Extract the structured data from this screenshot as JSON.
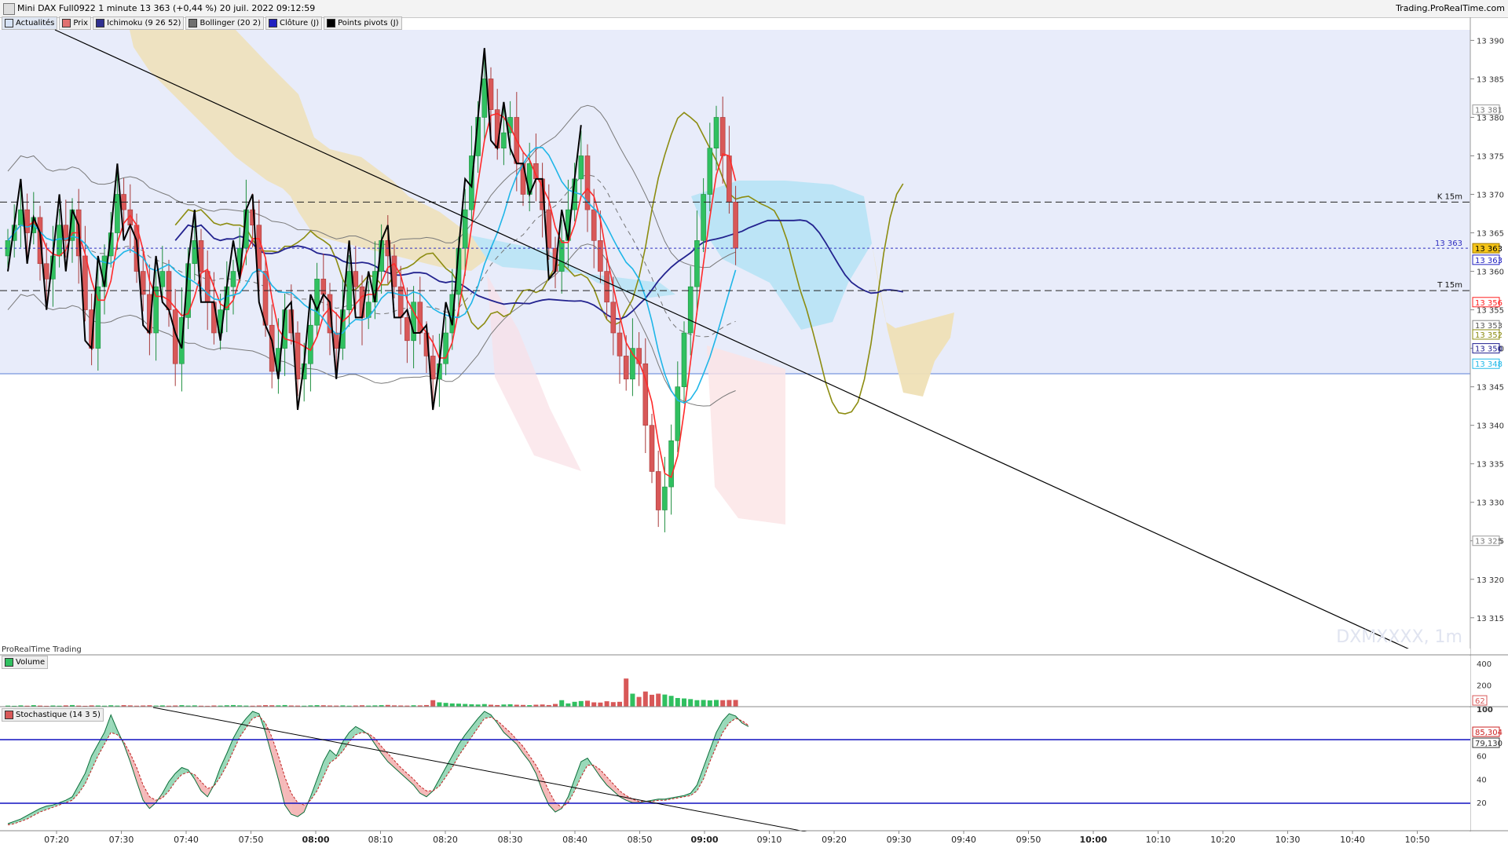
{
  "window": {
    "title": "Mini DAX Full0922 1 minute 13 363 (+0,44 %) 20 juil. 2022 09:12:59",
    "brand": "Trading.ProRealTime.com"
  },
  "legend": [
    {
      "label": "Actualités",
      "color": "#d6e2f5",
      "icon": "news-icon"
    },
    {
      "label": "Prix",
      "color": "#e07070",
      "icon": "price-icon"
    },
    {
      "label": "Ichimoku (9 26 52)",
      "color": "#303090",
      "icon": "ichimoku-icon"
    },
    {
      "label": "Bollinger (20 2)",
      "color": "#707070",
      "icon": "bollinger-icon"
    },
    {
      "label": "Clôture (J)",
      "color": "#2020c0",
      "icon": "close-daily-icon"
    },
    {
      "label": "Points pivots (J)",
      "color": "#000000",
      "icon": "pivot-icon"
    }
  ],
  "price_panel": {
    "axis_ticks": [
      "13 390",
      "13 385",
      "13 380",
      "13 375",
      "13 370",
      "13 365",
      "13 360",
      "13 355",
      "13 350",
      "13 345",
      "13 340",
      "13 335",
      "13 330",
      "13 325",
      "13 320",
      "13 315"
    ],
    "levels": [
      {
        "label": "K 15m",
        "value": 13369.0,
        "style": "dash-black"
      },
      {
        "label": "T 15m",
        "value": 13357.5,
        "style": "dash-black"
      },
      {
        "label": "13 363",
        "value": 13363.0,
        "style": "dot-blue"
      }
    ],
    "right_tags": [
      {
        "text": "13 381",
        "value": 13381,
        "fill": "#ffffff",
        "stroke": "#999999",
        "color": "#777777"
      },
      {
        "text": "13 363",
        "value": 13363,
        "fill": "#f5c518",
        "stroke": "#a07800",
        "color": "#000000"
      },
      {
        "text": "13 363",
        "value": 13361.5,
        "fill": "#ffffff",
        "stroke": "#2020c0",
        "color": "#2020c0"
      },
      {
        "text": "13 356",
        "value": 13356,
        "fill": "#ffffff",
        "stroke": "#ff2020",
        "color": "#ff2020"
      },
      {
        "text": "13 353",
        "value": 13353,
        "fill": "#ffffff",
        "stroke": "#888888",
        "color": "#555555"
      },
      {
        "text": "13 352",
        "value": 13351.8,
        "fill": "#ffffff",
        "stroke": "#8c8c10",
        "color": "#8c8c10"
      },
      {
        "text": "13 350",
        "value": 13350,
        "fill": "#ffffff",
        "stroke": "#202090",
        "color": "#202090"
      },
      {
        "text": "13 348",
        "value": 13348,
        "fill": "#ffffff",
        "stroke": "#20b8e8",
        "color": "#20b8e8"
      },
      {
        "text": "13 325",
        "value": 13325,
        "fill": "#ffffff",
        "stroke": "#999999",
        "color": "#777777"
      }
    ],
    "watermark": "DXMXXXX, 1m",
    "footer_label": "ProRealTime Trading"
  },
  "volume_panel": {
    "label": "Volume",
    "axis_ticks": [
      "400",
      "200"
    ],
    "tag": "62"
  },
  "stoch_panel": {
    "label": "Stochastique (14 3 5)",
    "axis_ticks": [
      "100",
      "80",
      "60",
      "40",
      "20"
    ],
    "tags": [
      {
        "text": "85,304",
        "color": "#cc2020"
      },
      {
        "text": "79,130",
        "color": "#333333"
      }
    ]
  },
  "time_axis": [
    {
      "label": "07:20",
      "bold": false
    },
    {
      "label": "07:30",
      "bold": false
    },
    {
      "label": "07:40",
      "bold": false
    },
    {
      "label": "07:50",
      "bold": false
    },
    {
      "label": "08:00",
      "bold": true
    },
    {
      "label": "08:10",
      "bold": false
    },
    {
      "label": "08:20",
      "bold": false
    },
    {
      "label": "08:30",
      "bold": false
    },
    {
      "label": "08:40",
      "bold": false
    },
    {
      "label": "08:50",
      "bold": false
    },
    {
      "label": "09:00",
      "bold": true
    },
    {
      "label": "09:10",
      "bold": false
    },
    {
      "label": "09:20",
      "bold": false
    },
    {
      "label": "09:30",
      "bold": false
    },
    {
      "label": "09:40",
      "bold": false
    },
    {
      "label": "09:50",
      "bold": false
    },
    {
      "label": "10:00",
      "bold": true
    },
    {
      "label": "10:10",
      "bold": false
    },
    {
      "label": "10:20",
      "bold": false
    },
    {
      "label": "10:30",
      "bold": false
    },
    {
      "label": "10:40",
      "bold": false
    },
    {
      "label": "10:50",
      "bold": false
    }
  ],
  "colors": {
    "up": "#30c060",
    "down": "#d85858",
    "panel_bg": "#e8ecfa"
  },
  "chart_data": {
    "type": "candlestick",
    "title": "Mini DAX Full0922 1 minute",
    "ylim": [
      13311,
      13393
    ],
    "close_series_note": "",
    "closes": [
      13364,
      13366,
      13368,
      13365,
      13367,
      13361,
      13359,
      13362,
      13366,
      13364,
      13368,
      13362,
      13355,
      13350,
      13358,
      13362,
      13365,
      13370,
      13368,
      13366,
      13360,
      13357,
      13352,
      13358,
      13360,
      13355,
      13348,
      13354,
      13361,
      13364,
      13360,
      13356,
      13352,
      13355,
      13358,
      13360,
      13363,
      13368,
      13366,
      13360,
      13353,
      13347,
      13350,
      13355,
      13352,
      13346,
      13348,
      13353,
      13359,
      13357,
      13352,
      13350,
      13355,
      13360,
      13358,
      13354,
      13356,
      13360,
      13364,
      13362,
      13358,
      13354,
      13351,
      13356,
      13352,
      13349,
      13346,
      13348,
      13352,
      13357,
      13363,
      13368,
      13375,
      13380,
      13385,
      13381,
      13376,
      13378,
      13380,
      13374,
      13370,
      13374,
      13372,
      13368,
      13363,
      13360,
      13364,
      13368,
      13372,
      13375,
      13368,
      13364,
      13360,
      13356,
      13352,
      13349,
      13346,
      13350,
      13348,
      13340,
      13334,
      13329,
      13332,
      13338,
      13345,
      13352,
      13358,
      13364,
      13370,
      13376,
      13380,
      13375,
      13369,
      13363
    ],
    "volumes": [
      10,
      8,
      12,
      9,
      14,
      10,
      8,
      11,
      9,
      12,
      15,
      10,
      8,
      12,
      11,
      9,
      13,
      10,
      14,
      12,
      9,
      11,
      13,
      10,
      12,
      9,
      11,
      14,
      10,
      12,
      9,
      8,
      11,
      10,
      13,
      15,
      12,
      10,
      9,
      11,
      14,
      13,
      12,
      15,
      11,
      10,
      9,
      12,
      14,
      13,
      11,
      10,
      12,
      9,
      11,
      13,
      10,
      12,
      14,
      16,
      12,
      11,
      10,
      13,
      12,
      15,
      60,
      40,
      35,
      30,
      28,
      25,
      22,
      20,
      24,
      18,
      15,
      20,
      22,
      18,
      16,
      14,
      18,
      20,
      15,
      25,
      60,
      30,
      45,
      52,
      55,
      40,
      38,
      50,
      42,
      45,
      260,
      120,
      90,
      140,
      110,
      120,
      112,
      100,
      80,
      76,
      70,
      60,
      62,
      58,
      62,
      60,
      62,
      62
    ],
    "stochastic_k": [
      2,
      4,
      6,
      9,
      12,
      15,
      17,
      18,
      20,
      22,
      25,
      35,
      45,
      60,
      70,
      80,
      95,
      82,
      70,
      55,
      38,
      22,
      15,
      20,
      28,
      38,
      45,
      50,
      48,
      40,
      30,
      25,
      35,
      50,
      62,
      75,
      85,
      92,
      98,
      96,
      80,
      60,
      40,
      18,
      10,
      8,
      12,
      25,
      40,
      55,
      65,
      60,
      72,
      80,
      85,
      82,
      78,
      70,
      62,
      55,
      50,
      45,
      40,
      35,
      28,
      25,
      30,
      40,
      50,
      60,
      70,
      78,
      85,
      92,
      98,
      95,
      88,
      80,
      75,
      70,
      62,
      55,
      45,
      30,
      18,
      12,
      15,
      25,
      40,
      55,
      58,
      50,
      42,
      35,
      30,
      25,
      22,
      20,
      20,
      21,
      22,
      23,
      23,
      24,
      25,
      26,
      28,
      35,
      50,
      65,
      80,
      90,
      96,
      94,
      88,
      85
    ],
    "stochastic_d": [
      1,
      2,
      4,
      6,
      9,
      12,
      14,
      16,
      18,
      20,
      22,
      28,
      36,
      48,
      60,
      70,
      80,
      78,
      72,
      62,
      50,
      35,
      25,
      22,
      24,
      30,
      38,
      44,
      46,
      44,
      38,
      32,
      34,
      42,
      52,
      64,
      76,
      84,
      92,
      94,
      88,
      76,
      60,
      42,
      28,
      20,
      18,
      22,
      30,
      42,
      54,
      58,
      64,
      72,
      78,
      80,
      79,
      75,
      68,
      62,
      56,
      50,
      45,
      40,
      34,
      30,
      30,
      34,
      42,
      50,
      60,
      68,
      76,
      84,
      92,
      93,
      90,
      85,
      80,
      74,
      68,
      60,
      52,
      42,
      30,
      20,
      16,
      20,
      30,
      42,
      52,
      52,
      48,
      42,
      36,
      30,
      26,
      23,
      21,
      21,
      21,
      22,
      22,
      23,
      24,
      25,
      26,
      30,
      40,
      55,
      68,
      80,
      88,
      92,
      90,
      86
    ]
  }
}
